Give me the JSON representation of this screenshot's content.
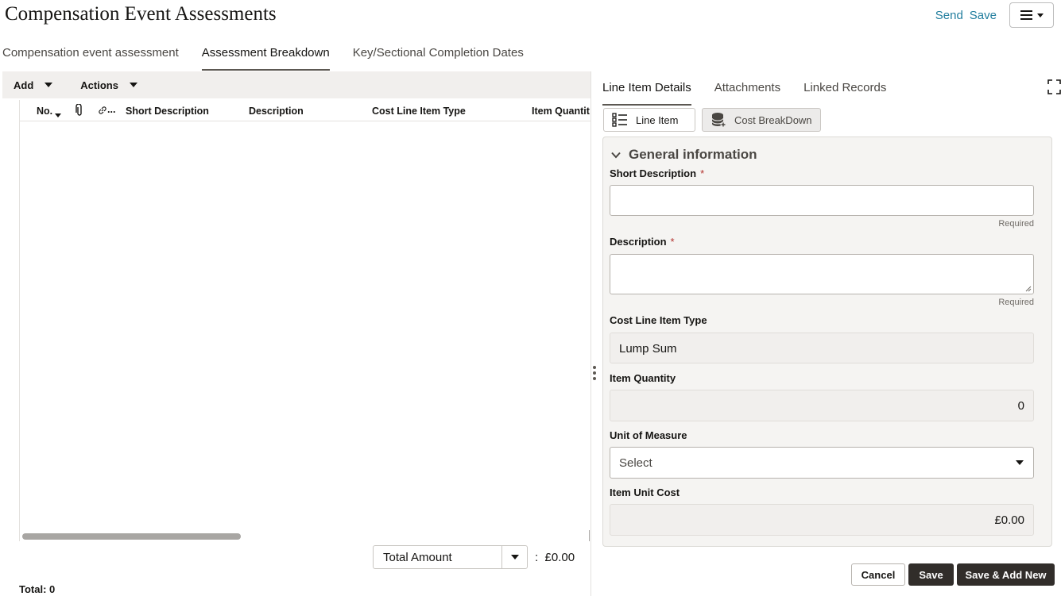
{
  "header": {
    "title": "Compensation Event Assessments",
    "send_label": "Send",
    "save_label": "Save"
  },
  "tabs": [
    {
      "label": "Compensation event assessment",
      "active": false
    },
    {
      "label": "Assessment Breakdown",
      "active": true
    },
    {
      "label": "Key/Sectional Completion Dates",
      "active": false
    }
  ],
  "toolbar": {
    "add_label": "Add",
    "actions_label": "Actions"
  },
  "table": {
    "columns": [
      "No.",
      "paperclip-icon",
      "link-icon",
      "Short Description",
      "Description",
      "Cost Line Item Type",
      "Item Quantit"
    ],
    "link_ellipsis": "...",
    "rows": []
  },
  "totals": {
    "select_value": "Total Amount",
    "separator": ":",
    "amount": "£0.00",
    "count_text": "Total: 0"
  },
  "detail": {
    "tabs": [
      {
        "label": "Line Item Details",
        "active": true
      },
      {
        "label": "Attachments",
        "active": false
      },
      {
        "label": "Linked Records",
        "active": false
      }
    ],
    "segments": {
      "line_item": "Line Item",
      "cost_breakdown": "Cost BreakDown"
    },
    "section_title": "General information",
    "fields": {
      "short_description": {
        "label": "Short Description",
        "required_mark": "*",
        "value": "",
        "hint": "Required"
      },
      "description": {
        "label": "Description",
        "required_mark": "*",
        "value": "",
        "hint": "Required"
      },
      "cost_line_item_type": {
        "label": "Cost Line Item Type",
        "value": "Lump Sum"
      },
      "item_quantity": {
        "label": "Item Quantity",
        "value": "0"
      },
      "unit_of_measure": {
        "label": "Unit of Measure",
        "value": "Select"
      },
      "item_unit_cost": {
        "label": "Item Unit Cost",
        "value": "£0.00"
      }
    }
  },
  "footer": {
    "cancel_label": "Cancel",
    "save_label": "Save",
    "save_add_new_label": "Save & Add New"
  },
  "colors": {
    "link": "#227e9e",
    "primary_button": "#312d2a",
    "required": "#b3322e"
  }
}
